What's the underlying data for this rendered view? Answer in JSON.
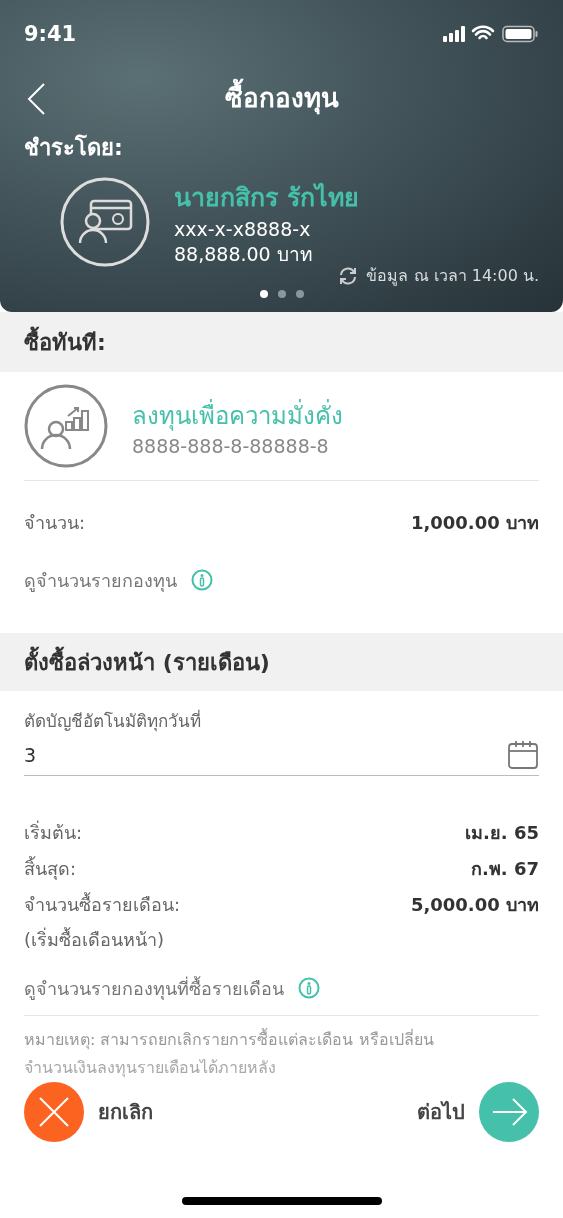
{
  "status_bar": {
    "time": "9:41"
  },
  "header": {
    "title": "ซื้อกองทุน",
    "pay_by_label": "ชำระโดย:",
    "account": {
      "name": "นายกสิกร รักไทย",
      "number": "xxx-x-x8888-x",
      "balance": "88,888.00 บาท"
    },
    "updated": "ข้อมูล ณ เวลา 14:00 น.",
    "page_dots": [
      {
        "selected": true
      },
      {
        "selected": false
      },
      {
        "selected": false
      }
    ]
  },
  "buy_now": {
    "heading": "ซื้อทันที:",
    "fund": {
      "name": "ลงทุนเพื่อความมั่งคั่ง",
      "number": "8888-888-8-88888-8"
    },
    "amount_label": "จำนวน:",
    "amount": "1,000.00 บาท",
    "detail_link": "ดูจำนวนรายกองทุน"
  },
  "schedule": {
    "heading": "ตั้งซื้อล่วงหน้า (รายเดือน)",
    "day_field": {
      "label": "ตัดบัญชีอัตโนมัติทุกวันที่",
      "value": "3"
    },
    "rows": [
      {
        "label": "เริ่มต้น:",
        "value": "เม.ย. 65"
      },
      {
        "label": "สิ้นสุด:",
        "value": "ก.พ. 67"
      },
      {
        "label": "จำนวนซื้อรายเดือน:",
        "value": "5,000.00 บาท"
      }
    ],
    "sub_note": "(เริ่มซื้อเดือนหน้า)",
    "detail_link": "ดูจำนวนรายกองทุนที่ซื้อรายเดือน",
    "note_lines": [
      "หมายเหตุ: สามารถยกเลิกรายการซื้อแต่ละเดือน หรือเปลี่ยน",
      "จำนวนเงินลงทุนรายเดือนได้ภายหลัง"
    ]
  },
  "actions": {
    "cancel": "ยกเลิก",
    "next": "ต่อไป"
  }
}
